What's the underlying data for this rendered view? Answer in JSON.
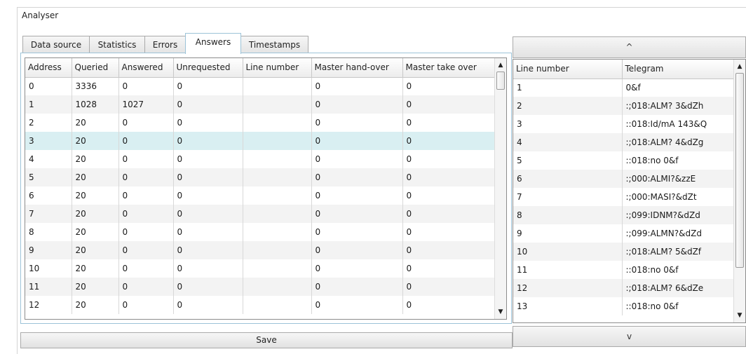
{
  "window": {
    "title": "Analyser"
  },
  "tabs": [
    {
      "label": "Data source",
      "active": false
    },
    {
      "label": "Statistics",
      "active": false
    },
    {
      "label": "Errors",
      "active": false
    },
    {
      "label": "Answers",
      "active": true
    },
    {
      "label": "Timestamps",
      "active": false
    }
  ],
  "answers_table": {
    "columns": [
      "Address",
      "Queried",
      "Answered",
      "Unrequested",
      "Line number",
      "Master hand-over",
      "Master take over"
    ],
    "selected_row": 3,
    "rows": [
      [
        "0",
        "3336",
        "0",
        "0",
        "",
        "0",
        "0"
      ],
      [
        "1",
        "1028",
        "1027",
        "0",
        "",
        "0",
        "0"
      ],
      [
        "2",
        "20",
        "0",
        "0",
        "",
        "0",
        "0"
      ],
      [
        "3",
        "20",
        "0",
        "0",
        "",
        "0",
        "0"
      ],
      [
        "4",
        "20",
        "0",
        "0",
        "",
        "0",
        "0"
      ],
      [
        "5",
        "20",
        "0",
        "0",
        "",
        "0",
        "0"
      ],
      [
        "6",
        "20",
        "0",
        "0",
        "",
        "0",
        "0"
      ],
      [
        "7",
        "20",
        "0",
        "0",
        "",
        "0",
        "0"
      ],
      [
        "8",
        "20",
        "0",
        "0",
        "",
        "0",
        "0"
      ],
      [
        "9",
        "20",
        "0",
        "0",
        "",
        "0",
        "0"
      ],
      [
        "10",
        "20",
        "0",
        "0",
        "",
        "0",
        "0"
      ],
      [
        "11",
        "20",
        "0",
        "0",
        "",
        "0",
        "0"
      ],
      [
        "12",
        "20",
        "0",
        "0",
        "",
        "0",
        "0"
      ]
    ]
  },
  "telegram_table": {
    "columns": [
      "Line number",
      "Telegram"
    ],
    "rows": [
      [
        "1",
        "0&f"
      ],
      [
        "2",
        ":;018:ALM? 3&dZh"
      ],
      [
        "3",
        "::018:Id/mA 143&Q"
      ],
      [
        "4",
        ":;018:ALM? 4&dZg"
      ],
      [
        "5",
        "::018:no 0&f"
      ],
      [
        "6",
        ":;000:ALMI?&zzE"
      ],
      [
        "7",
        ":;000:MASI?&dZt"
      ],
      [
        "8",
        ":;099:IDNM?&dZd"
      ],
      [
        "9",
        ":;099:ALMN?&dZd"
      ],
      [
        "10",
        ":;018:ALM? 5&dZf"
      ],
      [
        "11",
        "::018:no 0&f"
      ],
      [
        "12",
        ":;018:ALM? 6&dZe"
      ],
      [
        "13",
        "::018:no 0&f"
      ]
    ]
  },
  "buttons": {
    "up": "^",
    "down": "v",
    "save": "Save"
  },
  "scroll_icons": {
    "up": "▲",
    "down": "▼"
  },
  "colors": {
    "selected_row": "#d9eff2",
    "alt_row": "#f3f3f3",
    "active_tab_border": "#9cc3d8"
  }
}
